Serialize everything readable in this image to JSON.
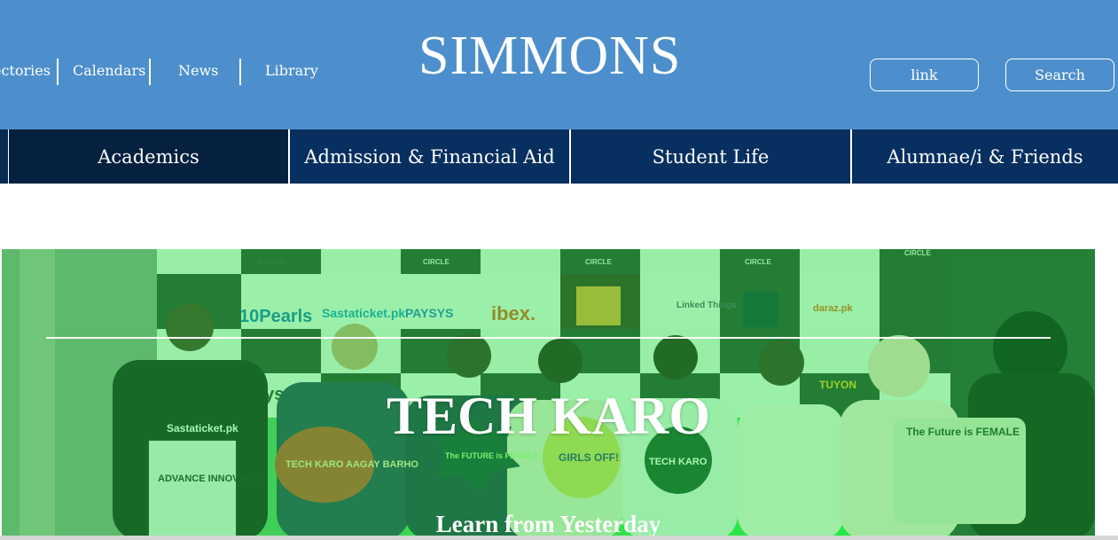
{
  "header": {
    "brand": "SIMMONS",
    "utility_links": [
      "ectories",
      "Calendars",
      "News",
      "Library"
    ],
    "link_button": "link",
    "search_button": "Search"
  },
  "main_nav": {
    "items": [
      {
        "label": "Academics",
        "active": true
      },
      {
        "label": "Admission & Financial Aid",
        "active": false
      },
      {
        "label": "Student Life",
        "active": false
      },
      {
        "label": "Alumnae/i & Friends",
        "active": false
      }
    ]
  },
  "hero": {
    "title": "TECH KARO",
    "subtitle": "Learn from Yesterday",
    "backdrop_logos": [
      "CIRCLE",
      "CIRCLE",
      "CIRCLE",
      "CIRCLE",
      "CIRCLE",
      "10Pearls",
      "Sastaticket.pk",
      "PAYSYS",
      "ibex.",
      "Linked Things",
      "daraz.pk",
      "systems",
      "TUYON"
    ],
    "signs": [
      "Sastaticket.pk",
      "ADVANCE INNOVATE",
      "TECH KARO AAGAY BARHO",
      "The FUTURE is FEMALE",
      "GIRLS OFF!",
      "TECH KARO",
      "The Future is FEMALE"
    ]
  },
  "colors": {
    "header_bg": "#4d8fcc",
    "nav_bg": "#072f5f",
    "nav_active_bg": "#05213f",
    "hero_tint": "#22ee48"
  }
}
